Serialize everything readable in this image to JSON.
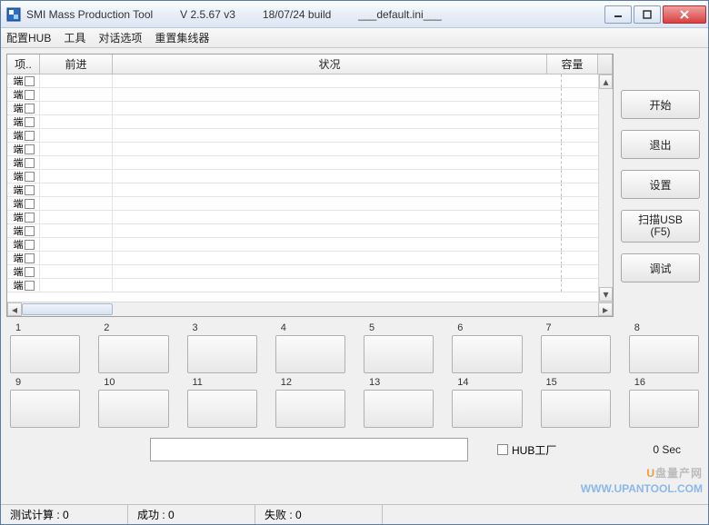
{
  "window": {
    "title_app": "SMI Mass Production Tool",
    "title_version": "V 2.5.67   v3",
    "title_build": "18/07/24 build",
    "title_ini": "___default.ini___"
  },
  "menu": {
    "configure_hub": "配置HUB",
    "tools": "工具",
    "dialog_options": "对话选项",
    "reset_hub": "重置集线器"
  },
  "table": {
    "col_item": "项..",
    "col_forward": "前进",
    "col_status": "状况",
    "col_capacity": "容量",
    "row_label": "端"
  },
  "buttons": {
    "start": "开始",
    "exit": "退出",
    "setting": "设置",
    "scan_usb": "扫描USB\n(F5)",
    "debug": "调试"
  },
  "slots": {
    "labels": [
      "1",
      "2",
      "3",
      "4",
      "5",
      "6",
      "7",
      "8",
      "9",
      "10",
      "11",
      "12",
      "13",
      "14",
      "15",
      "16"
    ]
  },
  "hub_factory_checkbox": "HUB工厂",
  "timer": "0 Sec",
  "status": {
    "test_count": "测试计算 : 0",
    "success": "成功 : 0",
    "fail": "失败 : 0"
  },
  "watermark": {
    "line1_u": "U",
    "line1_rest": "盘量产网",
    "line2": "WWW.UPANTOOL.COM"
  }
}
